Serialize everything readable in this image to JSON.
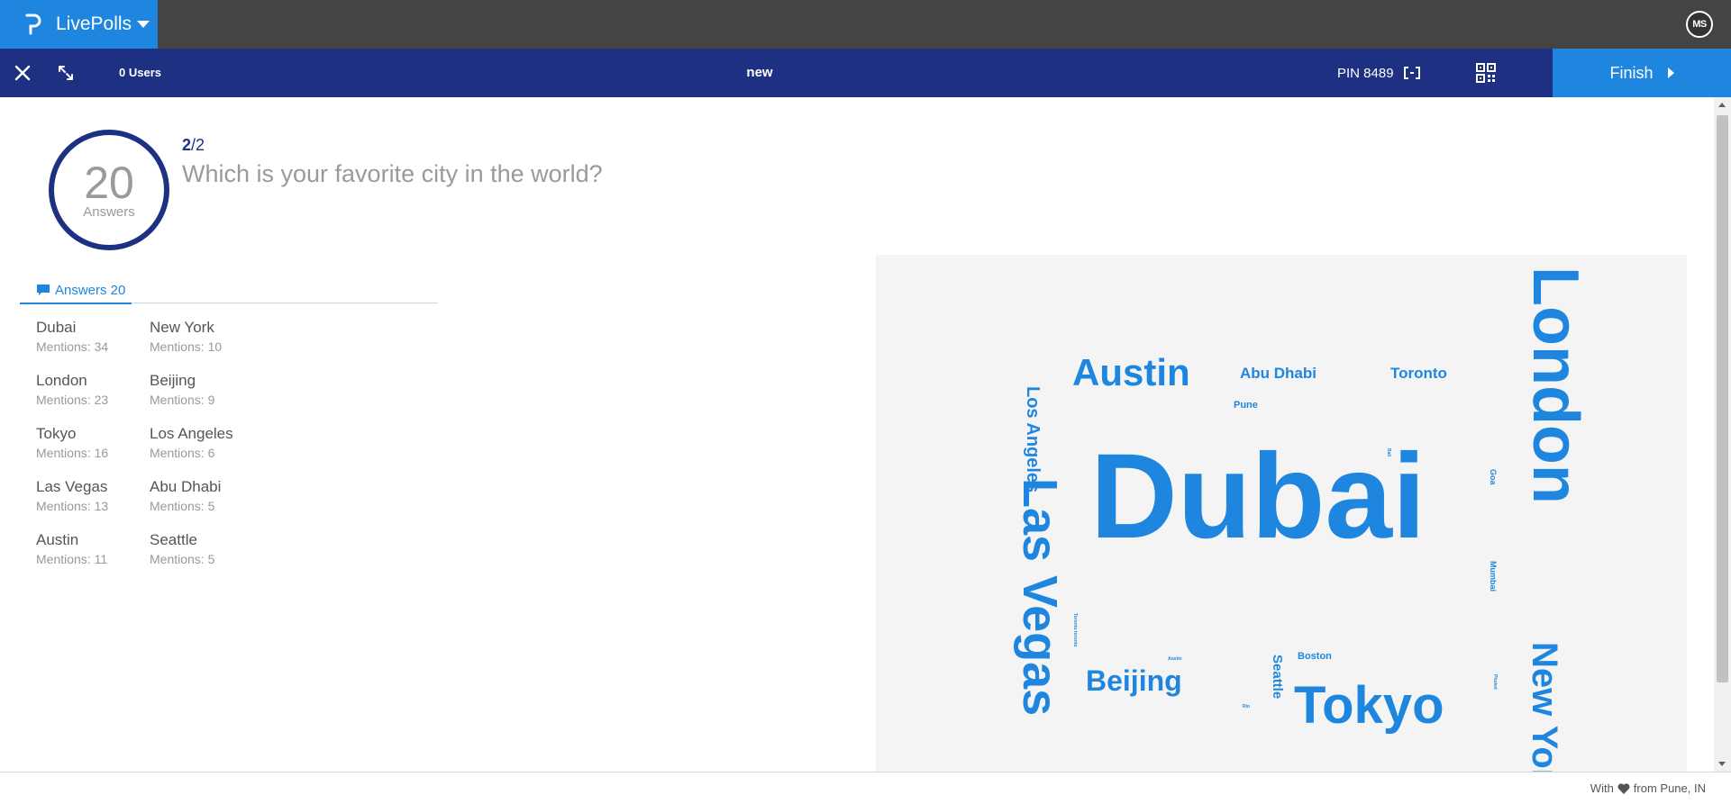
{
  "app": {
    "name": "LivePolls",
    "avatar_initials": "MS"
  },
  "session": {
    "users": "0 Users",
    "title": "new",
    "pin": "PIN 8489",
    "finish_label": "Finish"
  },
  "question": {
    "answer_count": "20",
    "answer_count_label": "Answers",
    "current": "2",
    "total": "/2",
    "text": "Which is your favorite city in the world?"
  },
  "answers_tab": {
    "label": "Answers 20"
  },
  "answers": [
    {
      "city": "Dubai",
      "mentions": "Mentions: 34"
    },
    {
      "city": "New York",
      "mentions": "Mentions: 10"
    },
    {
      "city": "London",
      "mentions": "Mentions: 23"
    },
    {
      "city": "Beijing",
      "mentions": "Mentions: 9"
    },
    {
      "city": "Tokyo",
      "mentions": "Mentions: 16"
    },
    {
      "city": "Los Angeles",
      "mentions": "Mentions: 6"
    },
    {
      "city": "Las Vegas",
      "mentions": "Mentions: 13"
    },
    {
      "city": "Abu Dhabi",
      "mentions": "Mentions: 5"
    },
    {
      "city": "Austin",
      "mentions": "Mentions: 11"
    },
    {
      "city": "Seattle",
      "mentions": "Mentions: 5"
    }
  ],
  "word_cloud": {
    "color": "#1f86e0",
    "words": [
      {
        "text": "Dubai"
      },
      {
        "text": "London"
      },
      {
        "text": "Las Vegas"
      },
      {
        "text": "Tokyo"
      },
      {
        "text": "Austin"
      },
      {
        "text": "New York"
      },
      {
        "text": "Beijing"
      },
      {
        "text": "Los Angeles"
      },
      {
        "text": "Abu Dhabi"
      },
      {
        "text": "Toronto"
      },
      {
        "text": "Seattle"
      },
      {
        "text": "Pune"
      },
      {
        "text": "Boston"
      },
      {
        "text": "Goa"
      },
      {
        "text": "Mumbai"
      },
      {
        "text": "Toronto toronto"
      },
      {
        "text": "Austin"
      },
      {
        "text": "Phuket"
      },
      {
        "text": "Bali"
      },
      {
        "text": "Rio"
      }
    ]
  },
  "footer": {
    "prefix": "With",
    "suffix": "from Pune, IN"
  },
  "colors": {
    "brand": "#1f86e0",
    "navy": "#1e3082",
    "topbar": "#444444"
  }
}
